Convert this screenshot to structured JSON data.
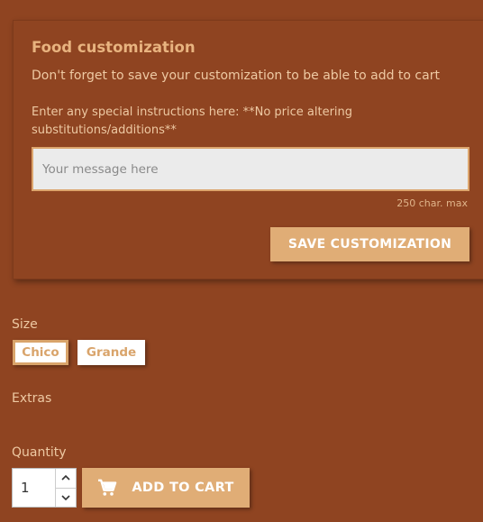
{
  "customization": {
    "title": "Food customization",
    "subtitle": "Don't forget to save your customization to be able to add to cart",
    "instructions": "Enter any special instructions here: **No price altering substitutions/additions**",
    "message_placeholder": "Your message here",
    "message_value": "",
    "char_max": "250 char. max",
    "save_label": "SAVE CUSTOMIZATION"
  },
  "size": {
    "label": "Size",
    "options": [
      "Chico",
      "Grande"
    ],
    "selected": "Chico"
  },
  "extras": {
    "label": "Extras"
  },
  "quantity": {
    "label": "Quantity",
    "value": "1"
  },
  "cart": {
    "add_label": "ADD TO CART",
    "icon": "cart-icon"
  },
  "colors": {
    "background": "#8f4421",
    "accent": "#e0ad76",
    "title": "#e8b37f",
    "text": "#eec9a3"
  }
}
